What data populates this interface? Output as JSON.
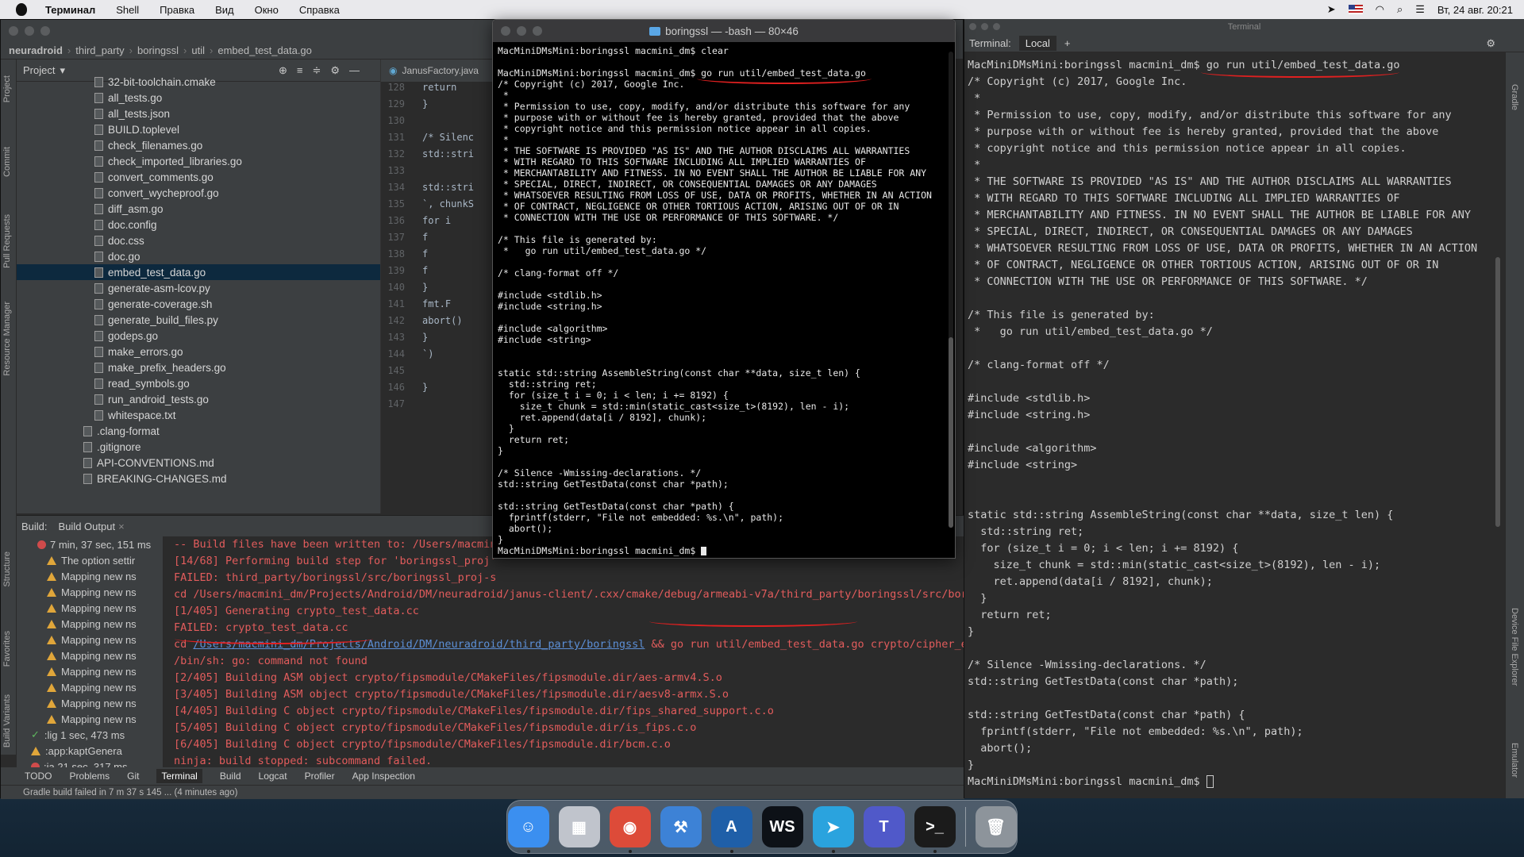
{
  "menubar": {
    "app": "Терминал",
    "items": [
      "Shell",
      "Правка",
      "Вид",
      "Окно",
      "Справка"
    ],
    "clock": "Вт, 24 авг. 20:21"
  },
  "ide": {
    "breadcrumb": [
      "neuradroid",
      "third_party",
      "boringssl",
      "util",
      "embed_test_data.go"
    ],
    "project_label": "Project",
    "project_files": [
      {
        "name": "32-bit-toolchain.cmake",
        "selected": false
      },
      {
        "name": "all_tests.go",
        "selected": false
      },
      {
        "name": "all_tests.json",
        "selected": false
      },
      {
        "name": "BUILD.toplevel",
        "selected": false
      },
      {
        "name": "check_filenames.go",
        "selected": false
      },
      {
        "name": "check_imported_libraries.go",
        "selected": false
      },
      {
        "name": "convert_comments.go",
        "selected": false
      },
      {
        "name": "convert_wycheproof.go",
        "selected": false
      },
      {
        "name": "diff_asm.go",
        "selected": false
      },
      {
        "name": "doc.config",
        "selected": false
      },
      {
        "name": "doc.css",
        "selected": false
      },
      {
        "name": "doc.go",
        "selected": false
      },
      {
        "name": "embed_test_data.go",
        "selected": true
      },
      {
        "name": "generate-asm-lcov.py",
        "selected": false
      },
      {
        "name": "generate-coverage.sh",
        "selected": false
      },
      {
        "name": "generate_build_files.py",
        "selected": false
      },
      {
        "name": "godeps.go",
        "selected": false
      },
      {
        "name": "make_errors.go",
        "selected": false
      },
      {
        "name": "make_prefix_headers.go",
        "selected": false
      },
      {
        "name": "read_symbols.go",
        "selected": false
      },
      {
        "name": "run_android_tests.go",
        "selected": false
      },
      {
        "name": "whitespace.txt",
        "selected": false
      },
      {
        "name": ".clang-format",
        "selected": false
      },
      {
        "name": ".gitignore",
        "selected": false
      },
      {
        "name": "API-CONVENTIONS.md",
        "selected": false
      },
      {
        "name": "BREAKING-CHANGES.md",
        "selected": false
      }
    ],
    "editor_tab": "JanusFactory.java",
    "editor_lines": [
      {
        "n": "128",
        "code": "return"
      },
      {
        "n": "129",
        "code": "}"
      },
      {
        "n": "130",
        "code": ""
      },
      {
        "n": "131",
        "code": "/* Silenc"
      },
      {
        "n": "132",
        "code": "std::stri"
      },
      {
        "n": "133",
        "code": ""
      },
      {
        "n": "134",
        "code": "std::stri"
      },
      {
        "n": "135",
        "code": "`, chunkS"
      },
      {
        "n": "136",
        "code": "  for i"
      },
      {
        "n": "137",
        "code": "      f"
      },
      {
        "n": "138",
        "code": "      f"
      },
      {
        "n": "139",
        "code": "      f"
      },
      {
        "n": "140",
        "code": "  }"
      },
      {
        "n": "141",
        "code": "    fmt.F"
      },
      {
        "n": "142",
        "code": "  abort()"
      },
      {
        "n": "143",
        "code": "}"
      },
      {
        "n": "144",
        "code": "`)"
      },
      {
        "n": "145",
        "code": ""
      },
      {
        "n": "146",
        "code": "}"
      },
      {
        "n": "147",
        "code": ""
      }
    ],
    "build_label": "Build:",
    "build_tab": "Build Output",
    "build_tree": [
      {
        "kind": "error",
        "text": "7 min, 37 sec, 151 ms"
      },
      {
        "kind": "warn",
        "text": "The option settir"
      },
      {
        "kind": "warn",
        "text": "Mapping new ns"
      },
      {
        "kind": "warn",
        "text": "Mapping new ns"
      },
      {
        "kind": "warn",
        "text": "Mapping new ns"
      },
      {
        "kind": "warn",
        "text": "Mapping new ns"
      },
      {
        "kind": "warn",
        "text": "Mapping new ns"
      },
      {
        "kind": "warn",
        "text": "Mapping new ns"
      },
      {
        "kind": "warn",
        "text": "Mapping new ns"
      },
      {
        "kind": "warn",
        "text": "Mapping new ns"
      },
      {
        "kind": "warn",
        "text": "Mapping new ns"
      },
      {
        "kind": "warn",
        "text": "Mapping new ns"
      },
      {
        "kind": "ok",
        "text": ":lig 1 sec, 473 ms"
      },
      {
        "kind": "warn",
        "text": ":app:kaptGenera"
      },
      {
        "kind": "error",
        "text": ":ja 21 sec, 317 ms"
      }
    ],
    "build_output": [
      {
        "text": "-- Build files have been written to: /Users/macmin"
      },
      {
        "text": "[14/68] Performing build step for 'boringssl_proj'"
      },
      {
        "text": "FAILED: third_party/boringssl/src/boringssl_proj-s"
      },
      {
        "text": "cd /Users/macmini_dm/Projects/Android/DM/neuradroid/janus-client/.cxx/cmake/debug/armeabi-v7a/third_party/boringssl/src/bori"
      },
      {
        "text": "[1/405] Generating crypto_test_data.cc"
      },
      {
        "text": "FAILED: crypto_test_data.cc"
      },
      {
        "text": "cd ",
        "link": "/Users/macmini_dm/Projects/Android/DM/neuradroid/third_party/boringssl",
        "rest": " && go run util/embed_test_data.go crypto/cipher_ex"
      },
      {
        "text": "/bin/sh: go: command not found"
      },
      {
        "text": "[2/405] Building ASM object crypto/fipsmodule/CMakeFiles/fipsmodule.dir/aes-armv4.S.o"
      },
      {
        "text": "[3/405] Building ASM object crypto/fipsmodule/CMakeFiles/fipsmodule.dir/aesv8-armx.S.o"
      },
      {
        "text": "[4/405] Building C object crypto/fipsmodule/CMakeFiles/fipsmodule.dir/fips_shared_support.c.o"
      },
      {
        "text": "[5/405] Building C object crypto/fipsmodule/CMakeFiles/fipsmodule.dir/is_fips.c.o"
      },
      {
        "text": "[6/405] Building C object crypto/fipsmodule/CMakeFiles/fipsmodule.dir/bcm.c.o"
      },
      {
        "text": "ninja: build stopped: subcommand failed."
      }
    ],
    "bottom_tools": [
      "TODO",
      "Problems",
      "Git",
      "Terminal",
      "Build",
      "Logcat",
      "Profiler",
      "App Inspection"
    ],
    "active_tool": "Terminal",
    "status": "Gradle build failed in 7 m 37 s 145 ... (4 minutes ago)",
    "left_vtabs": [
      "Project",
      "Commit",
      "Pull Requests",
      "Resource Manager",
      "Structure",
      "Favorites",
      "Build Variants"
    ],
    "right_vtabs": [
      "Gradle",
      "Device File Explorer",
      "Emulator"
    ]
  },
  "terminal": {
    "title": "boringssl — -bash — 80×46",
    "lines": [
      "MacMiniDMsMini:boringssl macmini_dm$ clear",
      "",
      "MacMiniDMsMini:boringssl macmini_dm$ go run util/embed_test_data.go",
      "/* Copyright (c) 2017, Google Inc.",
      " *",
      " * Permission to use, copy, modify, and/or distribute this software for any",
      " * purpose with or without fee is hereby granted, provided that the above",
      " * copyright notice and this permission notice appear in all copies.",
      " *",
      " * THE SOFTWARE IS PROVIDED \"AS IS\" AND THE AUTHOR DISCLAIMS ALL WARRANTIES",
      " * WITH REGARD TO THIS SOFTWARE INCLUDING ALL IMPLIED WARRANTIES OF",
      " * MERCHANTABILITY AND FITNESS. IN NO EVENT SHALL THE AUTHOR BE LIABLE FOR ANY",
      " * SPECIAL, DIRECT, INDIRECT, OR CONSEQUENTIAL DAMAGES OR ANY DAMAGES",
      " * WHATSOEVER RESULTING FROM LOSS OF USE, DATA OR PROFITS, WHETHER IN AN ACTION",
      " * OF CONTRACT, NEGLIGENCE OR OTHER TORTIOUS ACTION, ARISING OUT OF OR IN",
      " * CONNECTION WITH THE USE OR PERFORMANCE OF THIS SOFTWARE. */",
      "",
      "/* This file is generated by:",
      " *   go run util/embed_test_data.go */",
      "",
      "/* clang-format off */",
      "",
      "#include <stdlib.h>",
      "#include <string.h>",
      "",
      "#include <algorithm>",
      "#include <string>",
      "",
      "",
      "static std::string AssembleString(const char **data, size_t len) {",
      "  std::string ret;",
      "  for (size_t i = 0; i < len; i += 8192) {",
      "    size_t chunk = std::min(static_cast<size_t>(8192), len - i);",
      "    ret.append(data[i / 8192], chunk);",
      "  }",
      "  return ret;",
      "}",
      "",
      "/* Silence -Wmissing-declarations. */",
      "std::string GetTestData(const char *path);",
      "",
      "std::string GetTestData(const char *path) {",
      "  fprintf(stderr, \"File not embedded: %s.\\n\", path);",
      "  abort();",
      "}",
      "MacMiniDMsMini:boringssl macmini_dm$ "
    ]
  },
  "rterm": {
    "title": "Terminal",
    "label": "Terminal:",
    "tab": "Local",
    "lines": [
      "MacMiniDMsMini:boringssl macmini_dm$ go run util/embed_test_data.go",
      "/* Copyright (c) 2017, Google Inc.",
      " *",
      " * Permission to use, copy, modify, and/or distribute this software for any",
      " * purpose with or without fee is hereby granted, provided that the above",
      " * copyright notice and this permission notice appear in all copies.",
      " *",
      " * THE SOFTWARE IS PROVIDED \"AS IS\" AND THE AUTHOR DISCLAIMS ALL WARRANTIES",
      " * WITH REGARD TO THIS SOFTWARE INCLUDING ALL IMPLIED WARRANTIES OF",
      " * MERCHANTABILITY AND FITNESS. IN NO EVENT SHALL THE AUTHOR BE LIABLE FOR ANY",
      " * SPECIAL, DIRECT, INDIRECT, OR CONSEQUENTIAL DAMAGES OR ANY DAMAGES",
      " * WHATSOEVER RESULTING FROM LOSS OF USE, DATA OR PROFITS, WHETHER IN AN ACTION",
      " * OF CONTRACT, NEGLIGENCE OR OTHER TORTIOUS ACTION, ARISING OUT OF OR IN",
      " * CONNECTION WITH THE USE OR PERFORMANCE OF THIS SOFTWARE. */",
      "",
      "/* This file is generated by:",
      " *   go run util/embed_test_data.go */",
      "",
      "/* clang-format off */",
      "",
      "#include <stdlib.h>",
      "#include <string.h>",
      "",
      "#include <algorithm>",
      "#include <string>",
      "",
      "",
      "static std::string AssembleString(const char **data, size_t len) {",
      "  std::string ret;",
      "  for (size_t i = 0; i < len; i += 8192) {",
      "    size_t chunk = std::min(static_cast<size_t>(8192), len - i);",
      "    ret.append(data[i / 8192], chunk);",
      "  }",
      "  return ret;",
      "}",
      "",
      "/* Silence -Wmissing-declarations. */",
      "std::string GetTestData(const char *path);",
      "",
      "std::string GetTestData(const char *path) {",
      "  fprintf(stderr, \"File not embedded: %s.\\n\", path);",
      "  abort();",
      "}",
      "MacMiniDMsMini:boringssl macmini_dm$ "
    ]
  },
  "dock": [
    {
      "name": "finder",
      "glyph": "☺",
      "color": "#3b8ff0",
      "running": true
    },
    {
      "name": "launchpad",
      "glyph": "▦",
      "color": "#c0c4cc",
      "running": false
    },
    {
      "name": "chrome",
      "glyph": "◉",
      "color": "#dd4b39",
      "running": true
    },
    {
      "name": "xcode",
      "glyph": "⚒",
      "color": "#3d82d6",
      "running": false
    },
    {
      "name": "android-studio",
      "glyph": "A",
      "color": "#1f5fa8",
      "running": true
    },
    {
      "name": "webstorm",
      "glyph": "WS",
      "color": "#0d1117",
      "running": false
    },
    {
      "name": "telegram",
      "glyph": "➤",
      "color": "#2aa3de",
      "running": true
    },
    {
      "name": "teams",
      "glyph": "T",
      "color": "#5059c9",
      "running": false
    },
    {
      "name": "terminal",
      "glyph": ">_",
      "color": "#1b1b1b",
      "running": true
    },
    {
      "name": "trash",
      "glyph": "🗑",
      "color": "#8d949b",
      "running": false
    }
  ],
  "colors": {
    "accent_red": "#e02020",
    "selection": "#0d293e",
    "error_text": "#e25c5c"
  }
}
